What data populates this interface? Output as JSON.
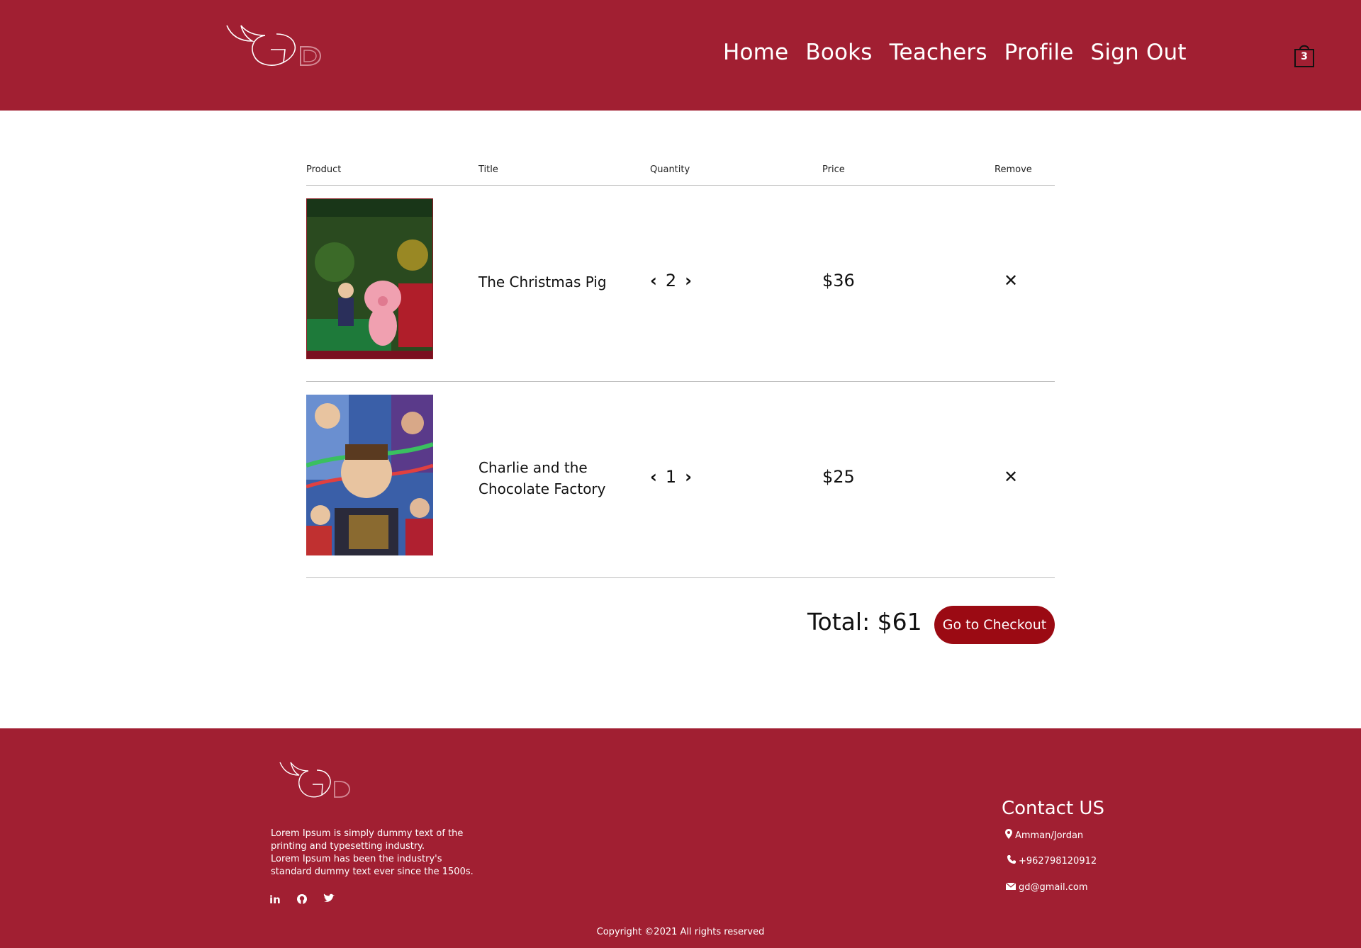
{
  "header": {
    "nav": [
      "Home",
      "Books",
      "Teachers",
      "Profile",
      "Sign Out"
    ],
    "cart_count": "3"
  },
  "table": {
    "headers": {
      "product": "Product",
      "title": "Title",
      "quantity": "Quantity",
      "price": "Price",
      "remove": "Remove"
    },
    "items": [
      {
        "title_line1": "The Christmas Pig",
        "title_line2": "",
        "quantity": "2",
        "price": "$36",
        "cover": "book-cover-christmas-pig"
      },
      {
        "title_line1": "Charlie and the",
        "title_line2": "Chocolate Factory",
        "quantity": "1",
        "price": "$25",
        "cover": "book-cover-charlie-chocolate-factory"
      }
    ]
  },
  "summary": {
    "total": "Total: $61",
    "checkout_label": "Go to Checkout"
  },
  "footer": {
    "about": [
      "Lorem Ipsum is simply dummy text of the",
      "printing and typesetting industry.",
      "Lorem Ipsum has been the industry's",
      "standard dummy text ever since the 1500s."
    ],
    "socials": [
      "linkedin-icon",
      "github-icon",
      "twitter-icon"
    ],
    "contact_title": "Contact US",
    "location": "Amman/Jordan",
    "phone": "+962798120912",
    "email": "gd@gmail.com",
    "copyright": "Copyright ©2021 All rights reserved"
  },
  "colors": {
    "brand": "#a11f32",
    "checkout": "#9b0a13"
  }
}
